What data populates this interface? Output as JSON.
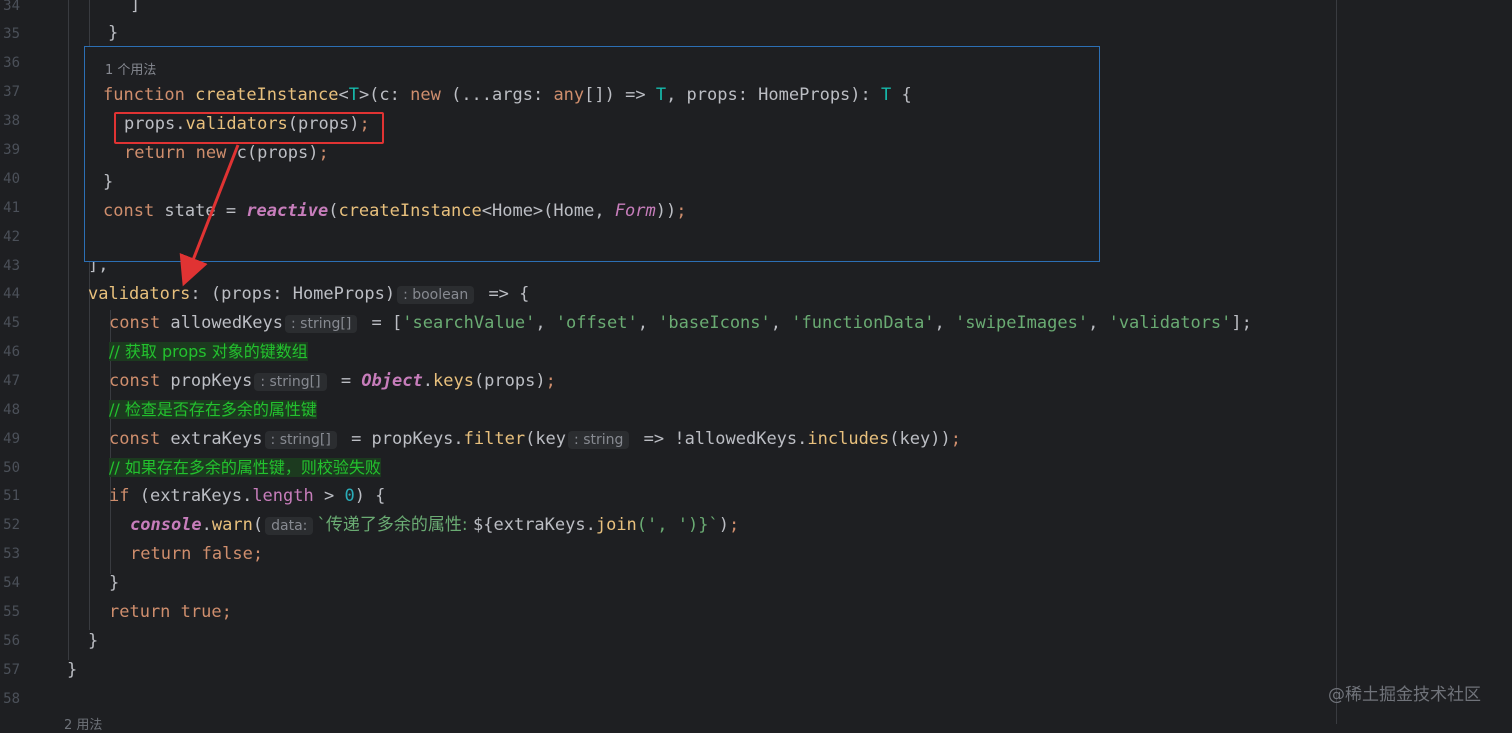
{
  "line_numbers": [
    "34",
    "35",
    "36",
    "37",
    "38",
    "39",
    "40",
    "41",
    "42",
    "43",
    "44",
    "45",
    "46",
    "47",
    "48",
    "49",
    "50",
    "51",
    "52",
    "53",
    "54",
    "55",
    "56",
    "57",
    "58"
  ],
  "popup": {
    "usage_label": "1 个用法",
    "l37": {
      "kw": "function",
      "name": "createInstance",
      "lt": "<",
      "tparam": "T",
      "rest1": ">(c: ",
      "kw2": "new",
      "rest2": " (...args: ",
      "kw3": "any",
      "rest3": "[]) => ",
      "tparam2": "T",
      "rest4": ", props: HomeProps): ",
      "tparam3": "T",
      "rest5": " {"
    },
    "l38": {
      "obj": "props",
      "dot": ".",
      "method": "validators",
      "args": "(props)",
      "semi": ";"
    },
    "l39": {
      "kw": "return",
      "kw2": "new",
      "rest": " c(props)",
      "semi": ";"
    },
    "l40": {
      "text": "}"
    },
    "l41": {
      "kw": "const",
      "var": " state = ",
      "fn": "reactive",
      "open": "(",
      "fn2": "createInstance",
      "gen": "<Home>(Home, ",
      "arg": "Form",
      "close": "))",
      "semi": ";"
    }
  },
  "code": {
    "l34": "]",
    "l35": "}",
    "l43": "],",
    "l44": {
      "name": "validators",
      "rest": ": (props: HomeProps)",
      "hint": ": boolean",
      "arrow": " => {"
    },
    "l45": {
      "kw": "const",
      "name": " allowedKeys",
      "hint": ": string[]",
      "eq": " = [",
      "s1": "'searchValue'",
      "s2": "'offset'",
      "s3": "'baseIcons'",
      "s4": "'functionData'",
      "s5": "'swipeImages'",
      "s6": "'validators'",
      "close": "];",
      "comma": ", "
    },
    "l46": "// 获取 props 对象的键数组",
    "l47": {
      "kw": "const",
      "name": " propKeys",
      "hint": ": string[]",
      "eq": " = ",
      "obj": "Object",
      "dot": ".",
      "fn": "keys",
      "rest": "(props)",
      "semi": ";"
    },
    "l48": "// 检查是否存在多余的属性键",
    "l49": {
      "kw": "const",
      "name": " extraKeys",
      "hint": ": string[]",
      "eq": " = propKeys.",
      "fn": "filter",
      "open": "(key",
      "hint2": ": string",
      "arrow": " => !allowedKeys.",
      "fn2": "includes",
      "close": "(key))",
      "semi": ";"
    },
    "l50": "// 如果存在多余的属性键，则校验失败",
    "l51": {
      "kw": "if",
      "open": " (extraKeys.",
      "prop": "length",
      "rest": " > ",
      "num": "0",
      "close": ") {"
    },
    "l52": {
      "obj": "console",
      "dot": ".",
      "fn": "warn",
      "open": "(",
      "hint": "data:",
      "tpl": "`传递了多余的属性: ",
      "interp": "${extraKeys.",
      "fn2": "join",
      "args": "(', ')",
      "end": "}`",
      "close": ")",
      "semi": ";"
    },
    "l53": {
      "kw": "return",
      "val": " false",
      "semi": ";"
    },
    "l54": "}",
    "l55": {
      "kw": "return",
      "val": " true",
      "semi": ";"
    },
    "l56": "}",
    "l57": "}"
  },
  "bottom_hint": "2 用法",
  "watermark": "@稀土掘金技术社区",
  "colors": {
    "background": "#1e1f22",
    "popup_border": "#2c6fb4",
    "highlight_box": "#e03333",
    "arrow": "#e03333",
    "comment": "#23c22e"
  }
}
